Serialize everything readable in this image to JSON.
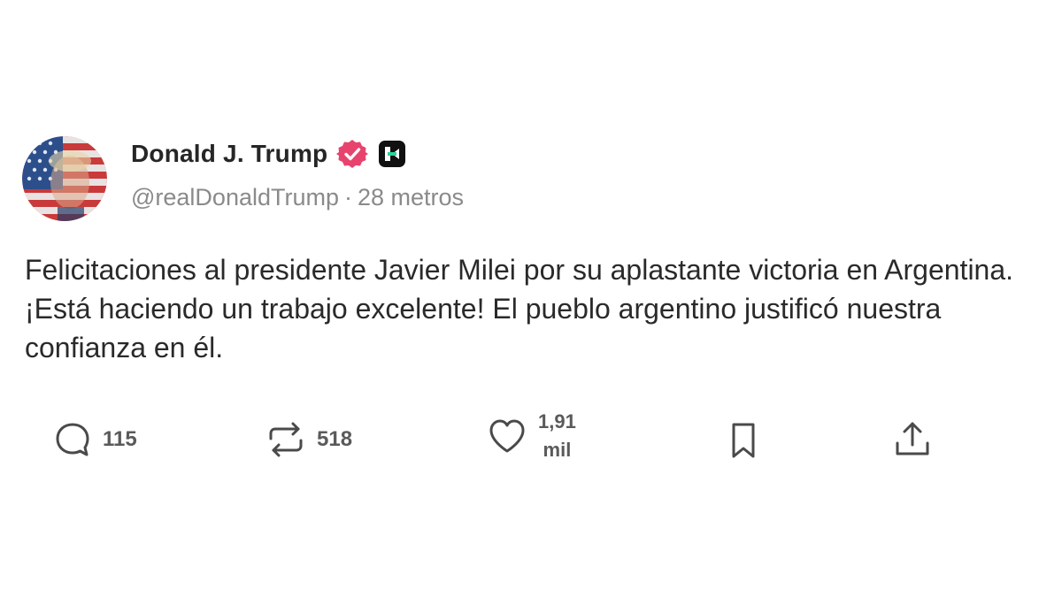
{
  "author": {
    "display_name": "Donald J. Trump",
    "handle": "@realDonaldTrump",
    "time_ago": "28 metros",
    "separator": "·",
    "verified_color": "#e8436d",
    "avatar_icon": "american-flag-portrait"
  },
  "post": {
    "text": "Felicitaciones al presidente Javier Milei por su aplastante victoria en Argentina. ¡Está haciendo un trabajo excelente! El pueblo argentino justificó nuestra confianza en él."
  },
  "actions": {
    "replies": "115",
    "reposts": "518",
    "likes_top": "1,91",
    "likes_bottom": "mil"
  }
}
